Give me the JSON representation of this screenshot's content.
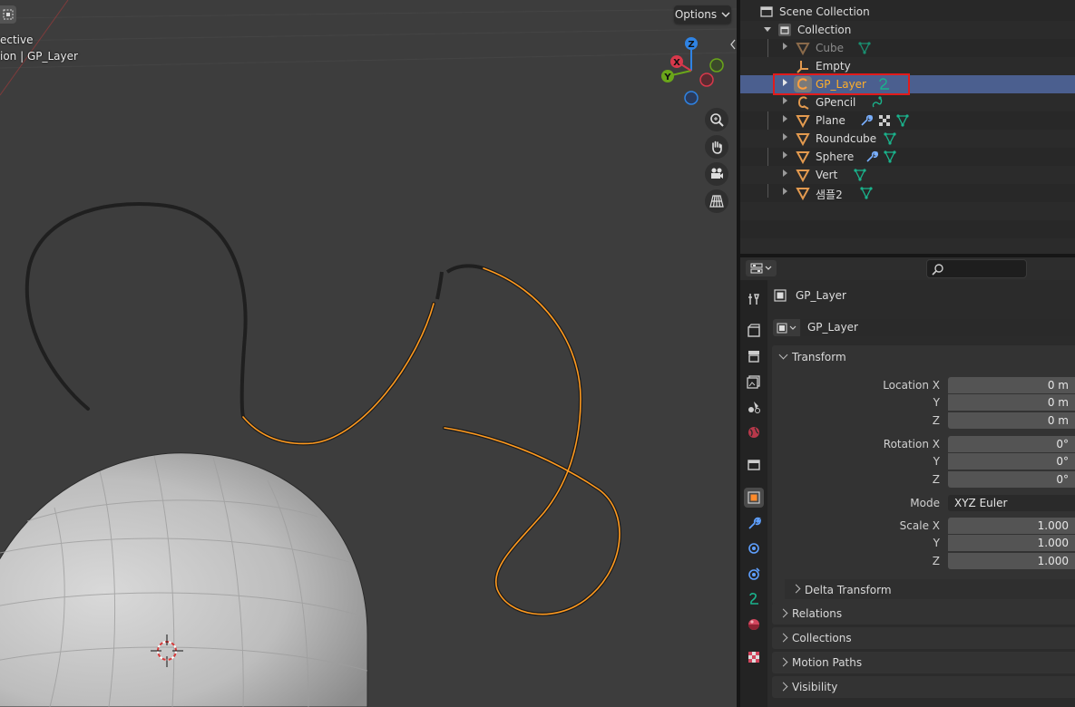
{
  "viewport": {
    "view_name": "ective",
    "object_info": "ion | GP_Layer",
    "options_label": "Options",
    "gizmo": {
      "z": "Z",
      "y": "Y",
      "x": "X"
    }
  },
  "outliner": {
    "scene_collection": "Scene Collection",
    "collection": "Collection",
    "items": [
      {
        "label": "Cube",
        "type": "mesh"
      },
      {
        "label": "Empty",
        "type": "empty"
      },
      {
        "label": "GP_Layer",
        "type": "gpencil"
      },
      {
        "label": "GPencil",
        "type": "gpencil"
      },
      {
        "label": "Plane",
        "type": "mesh"
      },
      {
        "label": "Roundcube",
        "type": "mesh"
      },
      {
        "label": "Sphere",
        "type": "mesh"
      },
      {
        "label": "Vert",
        "type": "mesh"
      },
      {
        "label": "샘플2",
        "type": "mesh"
      }
    ]
  },
  "properties": {
    "object_name": "GP_Layer",
    "datablock_name": "GP_Layer",
    "transform": {
      "title": "Transform",
      "location_label": "Location X",
      "y_label": "Y",
      "z_label": "Z",
      "location": [
        "0 m",
        "0 m",
        "0 m"
      ],
      "rotation_label": "Rotation X",
      "rotation": [
        "0°",
        "0°",
        "0°"
      ],
      "mode_label": "Mode",
      "mode_value": "XYZ Euler",
      "scale_label": "Scale X",
      "scale": [
        "1.000",
        "1.000",
        "1.000"
      ],
      "delta": "Delta Transform"
    },
    "panels": [
      "Relations",
      "Collections",
      "Motion Paths",
      "Visibility"
    ]
  },
  "colors": {
    "accent_orange": "#ffaf29",
    "selection_row": "#4b5f8f",
    "highlight_box": "#e21b1b",
    "stroke_selected": "#ff9a1f"
  }
}
